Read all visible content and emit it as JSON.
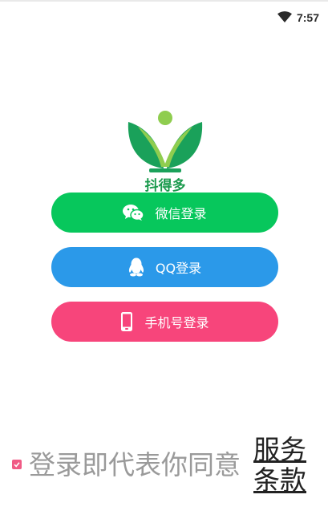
{
  "status_bar": {
    "time": "7:57",
    "icons": [
      "wifi-icon"
    ]
  },
  "logo": {
    "text": "抖得多",
    "colors": {
      "leaf_dark": "#1aa15a",
      "leaf_light": "#8fcd4f",
      "figure": "#8fcd4f",
      "text": "#1a9a4d"
    }
  },
  "buttons": {
    "wechat": {
      "label": "微信登录",
      "icon": "wechat-icon",
      "color": "#07c75c"
    },
    "qq": {
      "label": "QQ登录",
      "icon": "qq-icon",
      "color": "#2b99e9"
    },
    "phone": {
      "label": "手机号登录",
      "icon": "phone-icon",
      "color": "#f7457b"
    }
  },
  "agreement": {
    "checked": true,
    "text": "登录即代表你同意",
    "link": "服务条款"
  }
}
